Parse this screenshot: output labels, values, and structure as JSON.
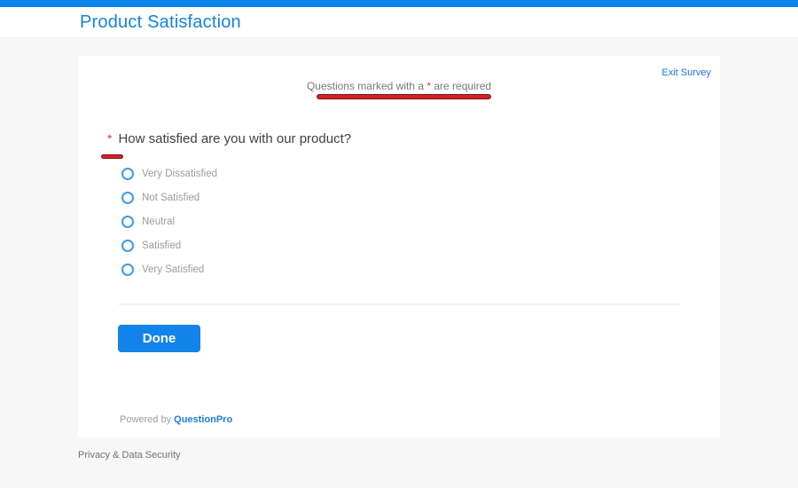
{
  "colors": {
    "accent_blue": "#1283e8",
    "top_bar_blue": "#0d84e8",
    "annotation_red": "#cf2424",
    "required_star_red": "#e53935",
    "page_background": "#f7f7f7"
  },
  "header": {
    "title": "Product Satisfaction"
  },
  "survey": {
    "exit_link": "Exit Survey",
    "required_note": {
      "prefix": "Questions marked with a ",
      "star": "*",
      "suffix": " are required"
    },
    "question": {
      "required_marker": "*",
      "text": "How satisfied are you with our product?",
      "options": [
        "Very Dissatisfied",
        "Not Satisfied",
        "Neutral",
        "Satisfied",
        "Very Satisfied"
      ]
    },
    "done_button": "Done",
    "powered_by_prefix": "Powered by ",
    "powered_by_brand": "QuestionPro"
  },
  "footer": {
    "privacy_link": "Privacy & Data Security"
  }
}
